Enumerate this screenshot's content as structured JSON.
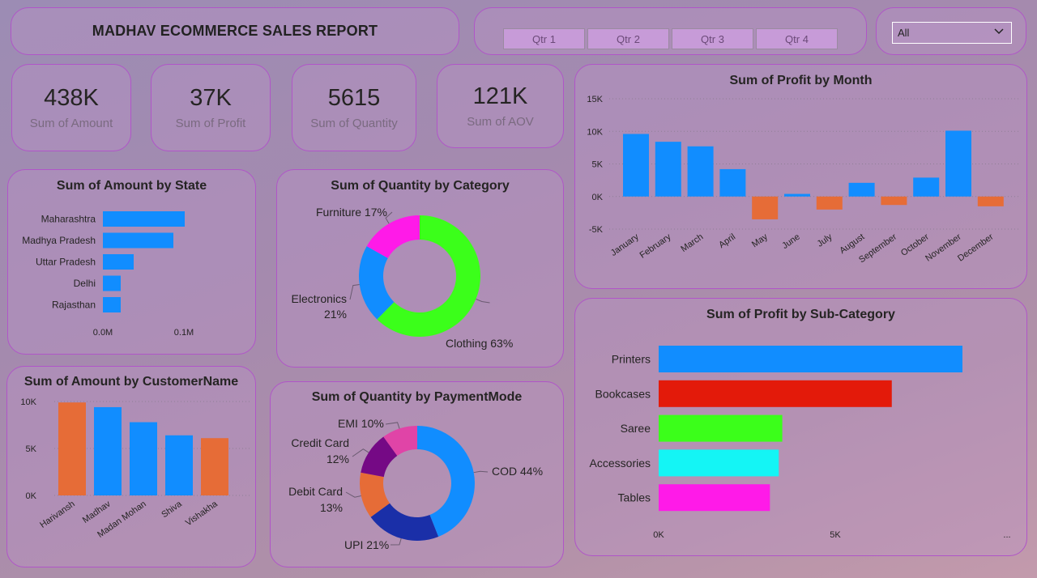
{
  "report_title": "MADHAV ECOMMERCE SALES REPORT",
  "quarters": [
    "Qtr 1",
    "Qtr 2",
    "Qtr 3",
    "Qtr 4"
  ],
  "filter": {
    "selected": "All"
  },
  "kpis": [
    {
      "value": "438K",
      "label": "Sum of Amount"
    },
    {
      "value": "37K",
      "label": "Sum of Profit"
    },
    {
      "value": "5615",
      "label": "Sum of Quantity"
    },
    {
      "value": "121K",
      "label": "Sum of AOV"
    }
  ],
  "colors": {
    "blue": "#118dff",
    "orange": "#e66c37",
    "green": "#3bff1a",
    "magenta": "#ff1ae8",
    "red": "#e31a0a",
    "cyan": "#14f5f5",
    "purple": "#750985",
    "navy": "#1a2fa8",
    "pink": "#e044a7"
  },
  "chart_data": [
    {
      "id": "amount_by_state",
      "type": "bar",
      "orientation": "horizontal",
      "title": "Sum of Amount by State",
      "categories": [
        "Maharashtra",
        "Madhya Pradesh",
        "Uttar Pradesh",
        "Delhi",
        "Rajasthan"
      ],
      "values": [
        0.101,
        0.087,
        0.038,
        0.022,
        0.022
      ],
      "xticks": [
        "0.0M",
        "0.1M"
      ],
      "xlim": [
        0,
        0.1
      ]
    },
    {
      "id": "quantity_by_category",
      "type": "pie",
      "donut": true,
      "title": "Sum of Quantity by Category",
      "slices": [
        {
          "label": "Clothing",
          "pct": 63,
          "text": "Clothing 63%",
          "color": "#3bff1a"
        },
        {
          "label": "Electronics",
          "pct": 21,
          "text_lines": [
            "Electronics",
            "21%"
          ],
          "color": "#118dff"
        },
        {
          "label": "Furniture",
          "pct": 17,
          "text": "Furniture 17%",
          "color": "#ff1ae8"
        }
      ]
    },
    {
      "id": "amount_by_customer",
      "type": "bar",
      "title": "Sum of Amount by CustomerName",
      "categories": [
        "Harivansh",
        "Madhav",
        "Madan Mohan",
        "Shiva",
        "Vishakha"
      ],
      "values": [
        9900,
        9400,
        7800,
        6400,
        6100
      ],
      "bar_colors": [
        "#e66c37",
        "#118dff",
        "#118dff",
        "#118dff",
        "#e66c37"
      ],
      "yticks": [
        "10K",
        "5K",
        "0K"
      ],
      "ylim": [
        0,
        10000
      ]
    },
    {
      "id": "quantity_by_payment",
      "type": "pie",
      "donut": true,
      "title": "Sum of Quantity by PaymentMode",
      "slices": [
        {
          "label": "COD",
          "pct": 44,
          "text": "COD 44%",
          "color": "#118dff"
        },
        {
          "label": "UPI",
          "pct": 21,
          "text": "UPI 21%",
          "color": "#1a2fa8"
        },
        {
          "label": "Debit Card",
          "pct": 13,
          "text_lines": [
            "Debit Card",
            "13%"
          ],
          "color": "#e66c37"
        },
        {
          "label": "Credit Card",
          "pct": 12,
          "text_lines": [
            "Credit Card",
            "12%"
          ],
          "color": "#750985"
        },
        {
          "label": "EMI",
          "pct": 10,
          "text": "EMI 10%",
          "color": "#e044a7"
        }
      ]
    },
    {
      "id": "profit_by_month",
      "type": "bar",
      "title": "Sum of Profit by Month",
      "categories": [
        "January",
        "February",
        "March",
        "April",
        "May",
        "June",
        "July",
        "August",
        "September",
        "October",
        "November",
        "December"
      ],
      "values": [
        9600,
        8400,
        7700,
        4200,
        -3500,
        400,
        -2000,
        2100,
        -1300,
        2900,
        10100,
        -1500
      ],
      "yticks": [
        "15K",
        "10K",
        "5K",
        "0K",
        "-5K"
      ],
      "ylim": [
        -5000,
        15000
      ]
    },
    {
      "id": "profit_by_subcategory",
      "type": "bar",
      "orientation": "horizontal",
      "title": "Sum of Profit by Sub-Category",
      "categories": [
        "Printers",
        "Bookcases",
        "Saree",
        "Accessories",
        "Tables"
      ],
      "values": [
        8600,
        6600,
        3500,
        3400,
        3150
      ],
      "bar_colors": [
        "#118dff",
        "#e31a0a",
        "#3bff1a",
        "#14f5f5",
        "#ff1ae8"
      ],
      "xticks": [
        "0K",
        "5K",
        "..."
      ],
      "xlim": [
        0,
        10000
      ]
    }
  ]
}
